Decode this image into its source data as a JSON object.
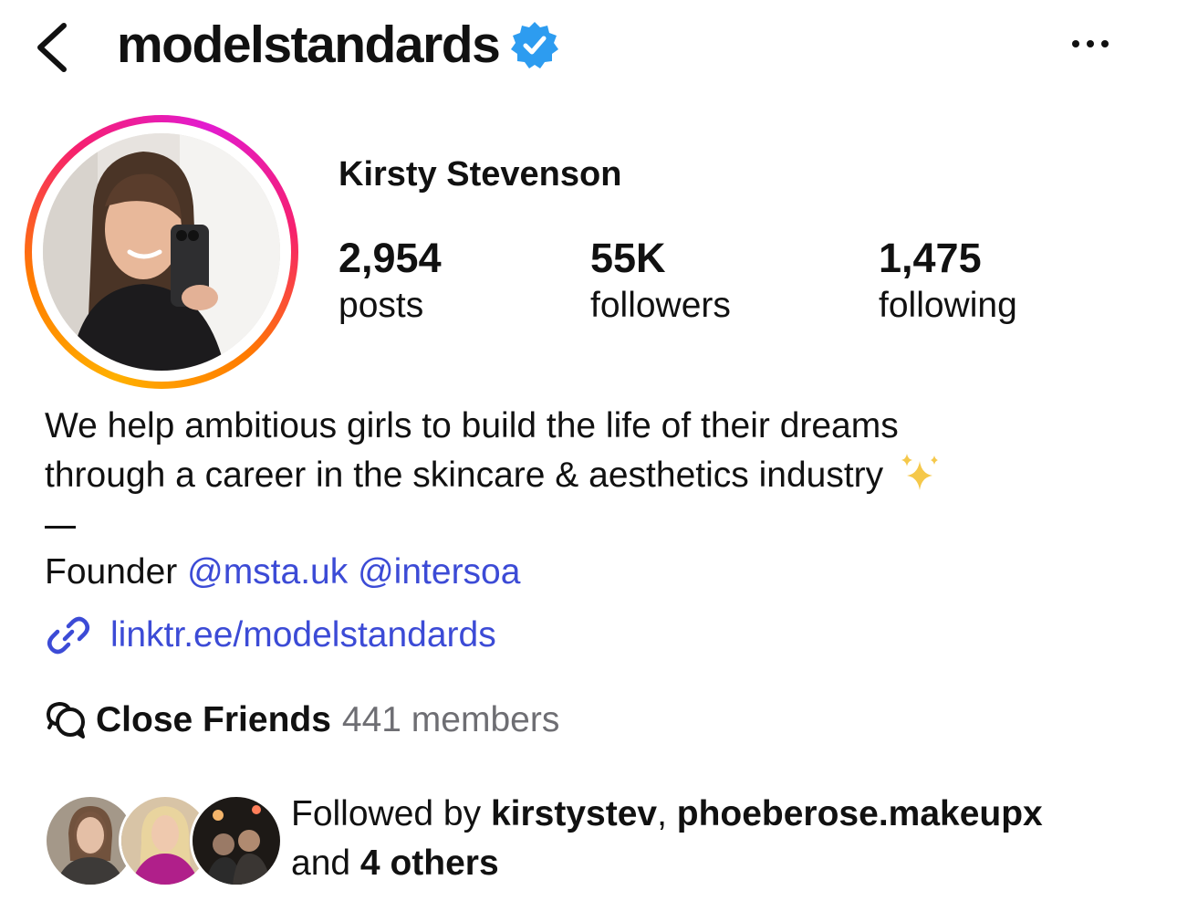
{
  "header": {
    "username": "modelstandards",
    "back_icon": "chevron-left-icon",
    "verified_icon": "verified-badge-icon",
    "more_icon": "ellipsis-icon"
  },
  "profile": {
    "full_name": "Kirsty Stevenson",
    "stats": [
      {
        "value": "2,954",
        "label": "posts"
      },
      {
        "value": "55K",
        "label": "followers"
      },
      {
        "value": "1,475",
        "label": "following"
      }
    ],
    "bio_lines": [
      "We help ambitious girls to build the life of their dreams",
      "through a career in the skincare & aesthetics industry"
    ],
    "founder_prefix": "Founder",
    "mentions": [
      "@msta.uk",
      "@intersoa"
    ],
    "link": "linktr.ee/modelstandards",
    "link_icon": "link-icon"
  },
  "close_friends": {
    "label": "Close Friends",
    "count": "441 members",
    "icon": "close-friends-icon"
  },
  "followed_by": {
    "prefix": "Followed by",
    "user1": "kirstystev",
    "separator": ", ",
    "user2": "phoeberose.makeupx",
    "and_text": "and",
    "others": "4 others"
  },
  "colors": {
    "link_blue": "#3c4bd6",
    "verified_blue": "#2d9cf0",
    "muted_gray": "#6e6e73",
    "story_ring_start": "#ffb000",
    "story_ring_end": "#e21bd0"
  }
}
